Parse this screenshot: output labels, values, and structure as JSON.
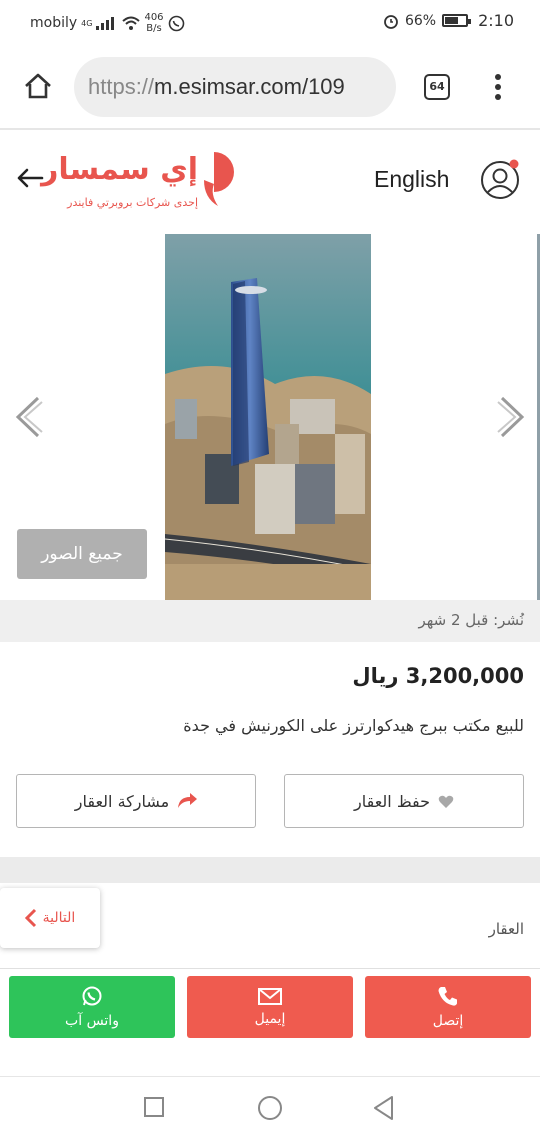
{
  "status_bar": {
    "carrier": "mobily",
    "network": "4G",
    "net_speed_value": "406",
    "net_speed_unit": "B/s",
    "battery_percent": "66%",
    "battery_level": 0.66,
    "time": "2:10"
  },
  "browser": {
    "url_scheme": "https://",
    "url_rest": "m.esimsar.com/109",
    "tab_count": "64"
  },
  "header": {
    "logo_name": "إي سمسار",
    "logo_tagline": "إحدى شركات بروبرتي فايندر",
    "language_label": "English"
  },
  "gallery": {
    "all_photos_label": "جميع الصور"
  },
  "listing": {
    "published": "نُشر: قبل 2 شهر",
    "price": "3,200,000 ريال",
    "title": "للبيع مكتب ببرج هيدكوارترز على الكورنيش في جدة",
    "save_label": "حفظ العقار",
    "share_label": "مشاركة العقار",
    "next_label": "التالية",
    "section_label": "العقار"
  },
  "contact": {
    "whatsapp_label": "واتس آب",
    "email_label": "إيميل",
    "call_label": "إتصل"
  },
  "colors": {
    "brand": "#e8554e",
    "whatsapp": "#2ec45a",
    "action": "#ef5b4f"
  }
}
